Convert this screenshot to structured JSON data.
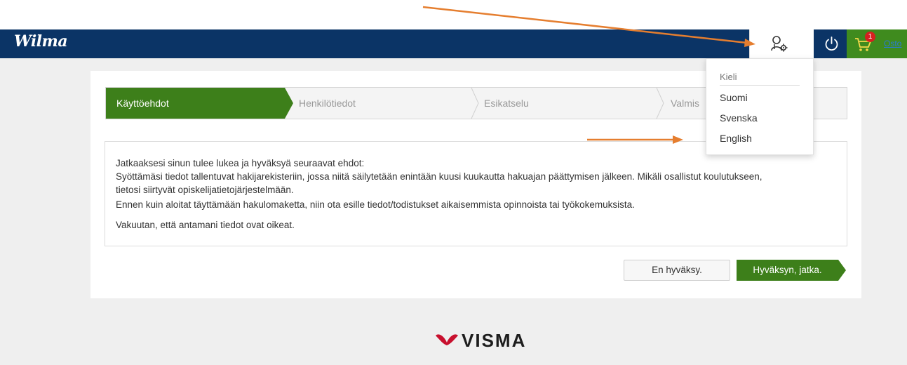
{
  "app": {
    "logo_text": "Wilma"
  },
  "header": {
    "user_settings_icon": "user-settings-icon",
    "power_icon": "power-icon",
    "cart_icon": "cart-icon",
    "cart_badge": "1",
    "cart_link": "Osto"
  },
  "stepper": {
    "steps": [
      {
        "label": "Käyttöehdot",
        "active": true
      },
      {
        "label": "Henkilötiedot",
        "active": false
      },
      {
        "label": "Esikatselu",
        "active": false
      },
      {
        "label": "Valmis",
        "active": false
      }
    ]
  },
  "terms": {
    "intro": "Jatkaaksesi sinun tulee lukea ja hyväksyä seuraavat ehdot:",
    "line1": "Syöttämäsi tiedot tallentuvat hakijarekisteriin, jossa niitä säilytetään enintään kuusi kuukautta hakuajan päättymisen jälkeen. Mikäli osallistut koulutukseen,",
    "line2": "tietosi siirtyvät opiskelijatietojärjestelmään.",
    "line3": "Ennen kuin aloitat täyttämään hakulomaketta, niin ota esille tiedot/todistukset aikaisemmista opinnoista tai työkokemuksista.",
    "confirm": "Vakuutan, että antamani tiedot ovat oikeat."
  },
  "actions": {
    "decline_label": "En hyväksy.",
    "accept_label": "Hyväksyn, jatka."
  },
  "language_menu": {
    "header": "Kieli",
    "options": [
      "Suomi",
      "Svenska",
      "English"
    ]
  },
  "footer": {
    "brand": "VISMA"
  },
  "colors": {
    "navbar": "#0b3466",
    "accent_green": "#3d7f1a",
    "annotation_arrow": "#e57e2f",
    "cart_bg": "#3f8b1e"
  }
}
